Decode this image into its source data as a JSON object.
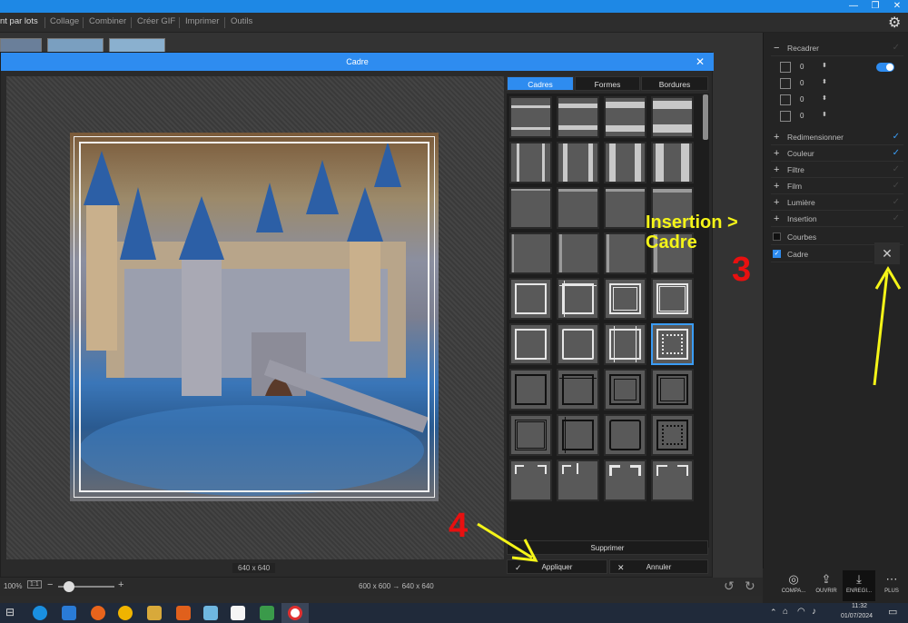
{
  "menu": {
    "items": [
      "nt par lots",
      "Collage",
      "Combiner",
      "Créer GIF",
      "Imprimer",
      "Outils"
    ]
  },
  "dialog": {
    "title": "Cadre",
    "tabs": [
      "Cadres",
      "Formes",
      "Bordures"
    ],
    "active_tab": "Cadres",
    "image_size": "640 x 640",
    "buttons": {
      "delete": "Supprimer",
      "apply": "Appliquer",
      "cancel": "Annuler"
    }
  },
  "right_panel": {
    "recadrer": "Recadrer",
    "values": [
      "0",
      "0",
      "0",
      "0"
    ],
    "items": [
      {
        "label": "Redimensionner",
        "checked": true
      },
      {
        "label": "Couleur",
        "checked": true
      },
      {
        "label": "Filtre",
        "checked": false
      },
      {
        "label": "Film",
        "checked": false
      },
      {
        "label": "Lumière",
        "checked": false
      },
      {
        "label": "Insertion",
        "checked": false
      }
    ],
    "courbes": "Courbes",
    "cadre": "Cadre"
  },
  "annotations": {
    "insertion_line1": "Insertion >",
    "insertion_line2": "Cadre",
    "step3": "3",
    "step4": "4"
  },
  "status": {
    "zoom": "100%",
    "ratio": "1:1",
    "dimensions": "600 x 600 → 640 x 640"
  },
  "bottom_buttons": {
    "compare": "COMPA...",
    "open": "OUVRIR",
    "save": "ENREGI...",
    "more": "PLUS"
  },
  "taskbar": {
    "time": "11:32",
    "date": "01/07/2024"
  },
  "colors": {
    "accent": "#2e8cf0",
    "annotation_yellow": "#f5f518",
    "annotation_red": "#e81010"
  }
}
